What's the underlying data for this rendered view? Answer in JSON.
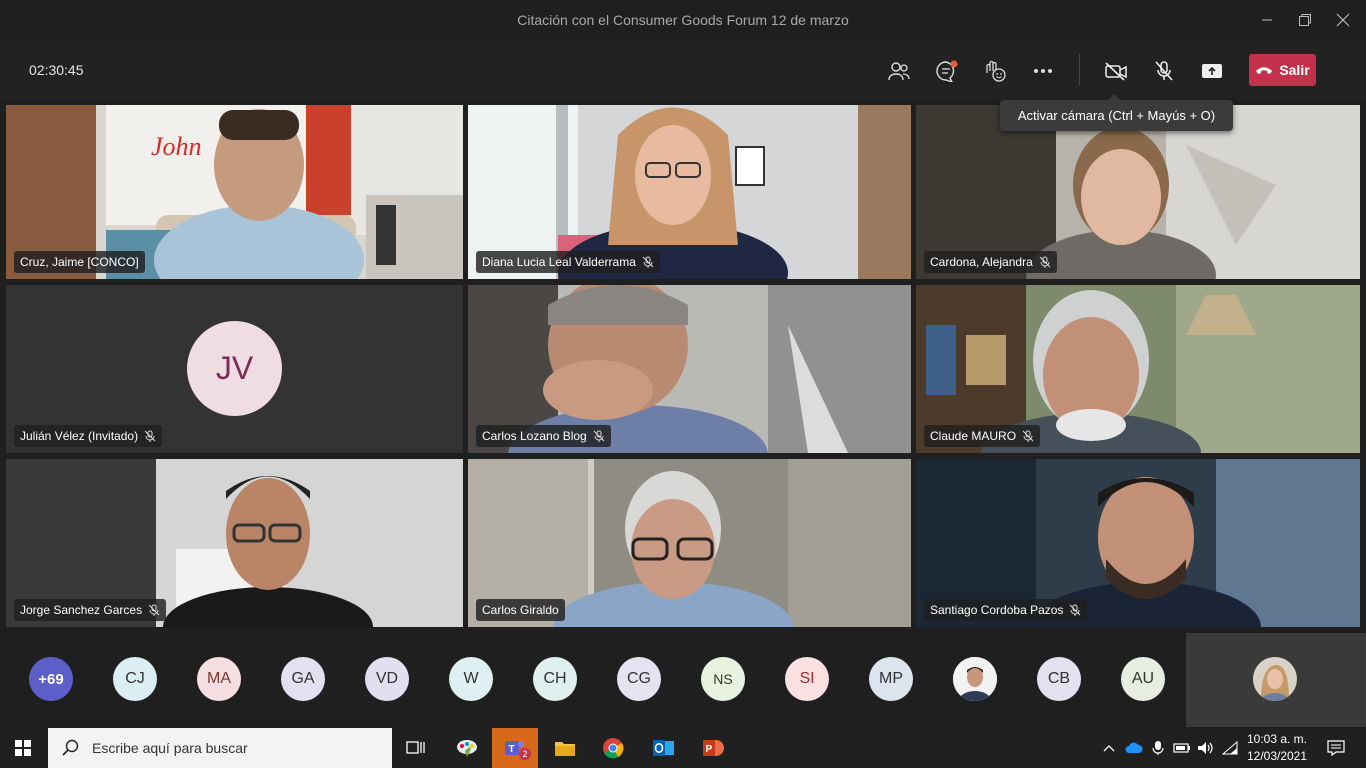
{
  "window": {
    "title": "Citación con el Consumer Goods Forum 12 de marzo"
  },
  "toolbar": {
    "timer": "02:30:45",
    "leave_label": "Salir",
    "tooltip": "Activar cámara (Ctrl + Mayús + O)",
    "icons": [
      "participants-icon",
      "chat-icon",
      "reactions-icon",
      "more-icon",
      "camera-off-icon",
      "mic-off-icon",
      "share-icon"
    ]
  },
  "participants": [
    {
      "name": "Cruz, Jaime [CONCO]",
      "muted": false
    },
    {
      "name": "Diana Lucia Leal Valderrama",
      "muted": true
    },
    {
      "name": "Cardona, Alejandra",
      "muted": true
    },
    {
      "name": "Julián Vélez (Invitado)",
      "muted": true,
      "initials": "JV"
    },
    {
      "name": "Carlos Lozano Blog",
      "muted": true
    },
    {
      "name": "Claude MAURO",
      "muted": true
    },
    {
      "name": "Jorge Sanchez Garces",
      "muted": true
    },
    {
      "name": "Carlos Giraldo",
      "muted": false
    },
    {
      "name": "Santiago Cordoba Pazos",
      "muted": true
    }
  ],
  "strip": {
    "overflow": "+69",
    "avatars": [
      {
        "initials": "CJ",
        "color": "#dbeef4"
      },
      {
        "initials": "MA",
        "color": "#f6dfe0"
      },
      {
        "initials": "GA",
        "color": "#e3e0f2"
      },
      {
        "initials": "VD",
        "color": "#e4def1"
      },
      {
        "initials": "W",
        "color": "#dff0f2"
      },
      {
        "initials": "CH",
        "color": "#dff0ef"
      },
      {
        "initials": "CG",
        "color": "#e6e3f0"
      },
      {
        "initials": "NS",
        "color": "#e7f2df"
      },
      {
        "initials": "SI",
        "color": "#fbe1e1"
      },
      {
        "initials": "MP",
        "color": "#dce5ee"
      },
      {
        "initials": "",
        "color": "#e9e9e9"
      },
      {
        "initials": "CB",
        "color": "#e4e0f0"
      },
      {
        "initials": "AU",
        "color": "#e7eedf"
      }
    ]
  },
  "taskbar": {
    "search_placeholder": "Escribe aquí para buscar",
    "time": "10:03 a. m.",
    "date": "12/03/2021",
    "teams_badge": "2"
  }
}
